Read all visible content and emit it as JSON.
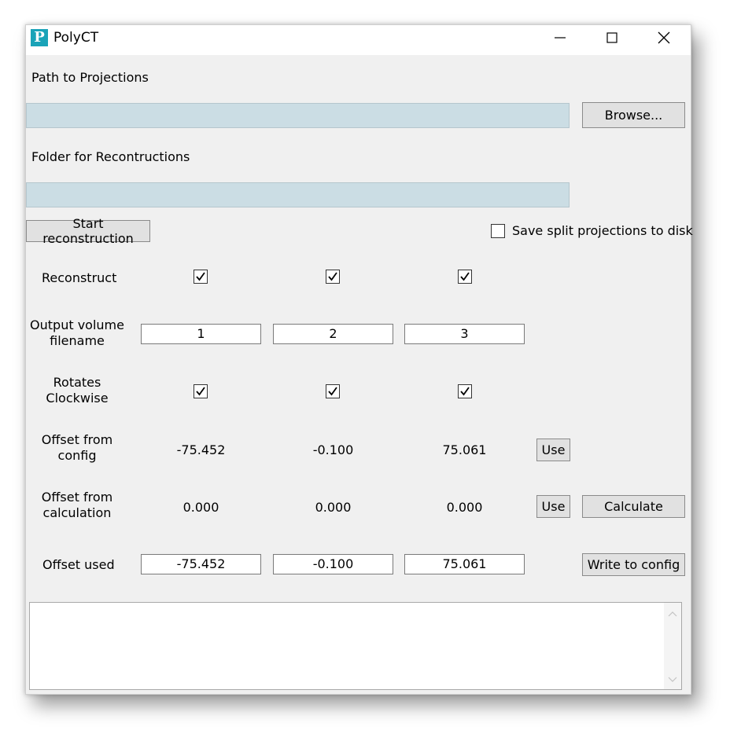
{
  "window": {
    "title": "PolyCT",
    "icon_letter": "P"
  },
  "projections": {
    "label": "Path to Projections",
    "value": "",
    "browse_label": "Browse..."
  },
  "reconstructions": {
    "label": "Folder for Recontructions",
    "value": ""
  },
  "start_label": "Start reconstruction",
  "save_split": {
    "label": "Save split projections to disk",
    "checked": false
  },
  "rows": {
    "reconstruct": "Reconstruct",
    "output": "Output volume filename",
    "rotates": "Rotates Clockwise",
    "offset_config": "Offset from config",
    "offset_calc": "Offset from calculation",
    "offset_used": "Offset used"
  },
  "columns": [
    {
      "reconstruct": true,
      "filename": "1",
      "rotates": true,
      "offset_config": "-75.452",
      "offset_calc": "0.000",
      "offset_used": "-75.452"
    },
    {
      "reconstruct": true,
      "filename": "2",
      "rotates": true,
      "offset_config": "-0.100",
      "offset_calc": "0.000",
      "offset_used": "-0.100"
    },
    {
      "reconstruct": true,
      "filename": "3",
      "rotates": true,
      "offset_config": "75.061",
      "offset_calc": "0.000",
      "offset_used": "75.061"
    }
  ],
  "buttons": {
    "use_config": "Use",
    "use_calc": "Use",
    "calculate": "Calculate",
    "write_config": "Write to config"
  },
  "log": ""
}
